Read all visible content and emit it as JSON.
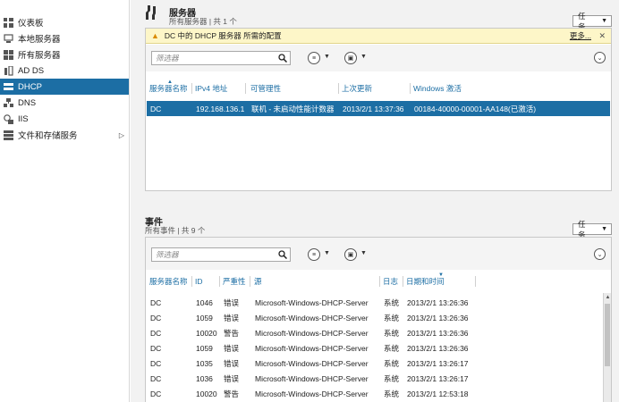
{
  "sidebar": {
    "items": [
      {
        "label": "仪表板",
        "icon": "dashboard-icon"
      },
      {
        "label": "本地服务器",
        "icon": "local-server-icon"
      },
      {
        "label": "所有服务器",
        "icon": "all-servers-icon"
      },
      {
        "label": "AD DS",
        "icon": "adds-icon"
      },
      {
        "label": "DHCP",
        "icon": "dhcp-icon",
        "active": true
      },
      {
        "label": "DNS",
        "icon": "dns-icon"
      },
      {
        "label": "IIS",
        "icon": "iis-icon"
      },
      {
        "label": "文件和存储服务",
        "icon": "file-storage-icon",
        "has_children": true
      }
    ]
  },
  "servers": {
    "title": "服务器",
    "subtitle": "所有服务器 | 共 1 个",
    "tasks_label": "任务",
    "warning_text": "DC 中的 DHCP 服务器 所需的配置",
    "warning_more": "更多...",
    "filter_placeholder": "筛选器",
    "columns": [
      "服务器名称",
      "IPv4 地址",
      "可管理性",
      "上次更新",
      "Windows 激活"
    ],
    "rows": [
      [
        "DC",
        "192.168.136.1",
        "联机 - 未启动性能计数器",
        "2013/2/1 13:37:36",
        "00184-40000-00001-AA148(已激活)"
      ]
    ]
  },
  "events": {
    "title": "事件",
    "subtitle": "所有事件 | 共 9 个",
    "tasks_label": "任务",
    "filter_placeholder": "筛选器",
    "columns": [
      "服务器名称",
      "ID",
      "严重性",
      "源",
      "日志",
      "日期和时间"
    ],
    "rows": [
      [
        "DC",
        "1046",
        "错误",
        "Microsoft-Windows-DHCP-Server",
        "系统",
        "2013/2/1 13:26:36"
      ],
      [
        "DC",
        "1059",
        "错误",
        "Microsoft-Windows-DHCP-Server",
        "系统",
        "2013/2/1 13:26:36"
      ],
      [
        "DC",
        "10020",
        "警告",
        "Microsoft-Windows-DHCP-Server",
        "系统",
        "2013/2/1 13:26:36"
      ],
      [
        "DC",
        "1059",
        "错误",
        "Microsoft-Windows-DHCP-Server",
        "系统",
        "2013/2/1 13:26:36"
      ],
      [
        "DC",
        "1035",
        "错误",
        "Microsoft-Windows-DHCP-Server",
        "系统",
        "2013/2/1 13:26:17"
      ],
      [
        "DC",
        "1036",
        "错误",
        "Microsoft-Windows-DHCP-Server",
        "系统",
        "2013/2/1 13:26:17"
      ],
      [
        "DC",
        "10020",
        "警告",
        "Microsoft-Windows-DHCP-Server",
        "系统",
        "2013/2/1 12:53:18"
      ]
    ]
  },
  "colors": {
    "accent": "#1c6ea4",
    "warning_bg": "#fdf6c8"
  }
}
